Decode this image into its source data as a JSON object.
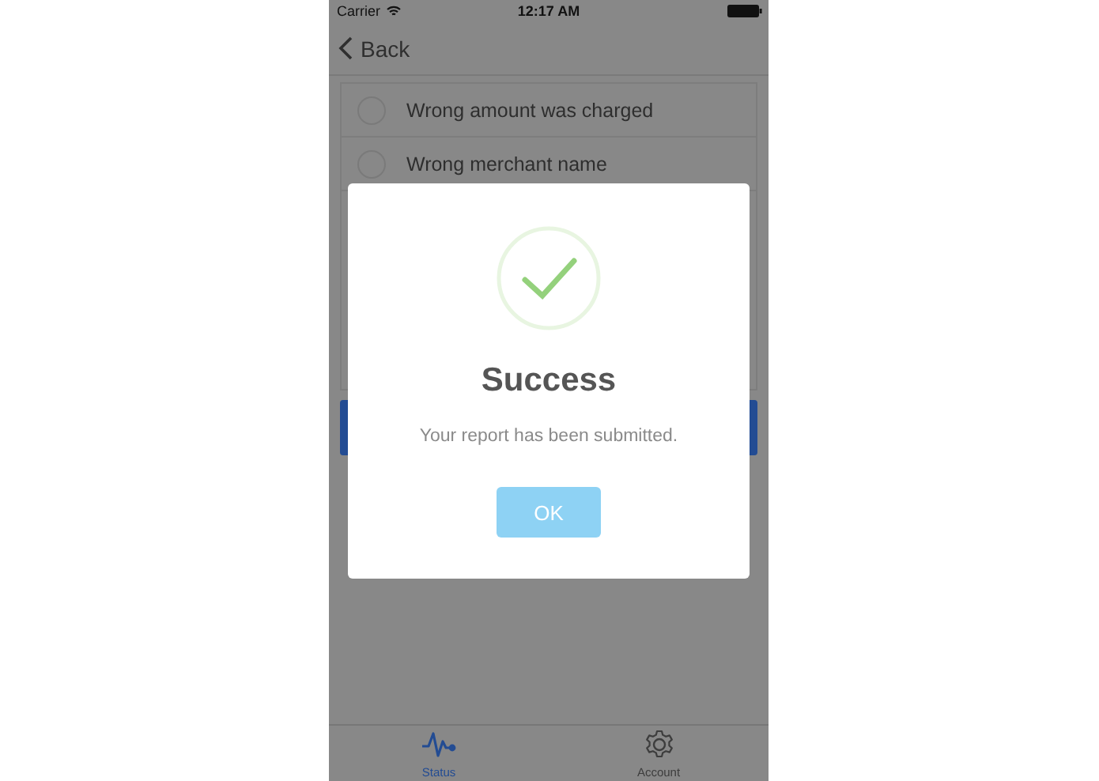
{
  "status_bar": {
    "carrier": "Carrier",
    "time": "12:17 AM"
  },
  "nav_bar": {
    "back": "Back"
  },
  "options": [
    {
      "label": "Wrong amount was charged",
      "selected": false
    },
    {
      "label": "Wrong merchant name",
      "selected": false
    }
  ],
  "dialog": {
    "title": "Success",
    "message": "Your report has been submitted.",
    "button": "OK"
  },
  "tabs": [
    {
      "label": "Status",
      "kind": "pulse",
      "selected": true
    },
    {
      "label": "Account",
      "kind": "gear",
      "selected": false
    }
  ]
}
